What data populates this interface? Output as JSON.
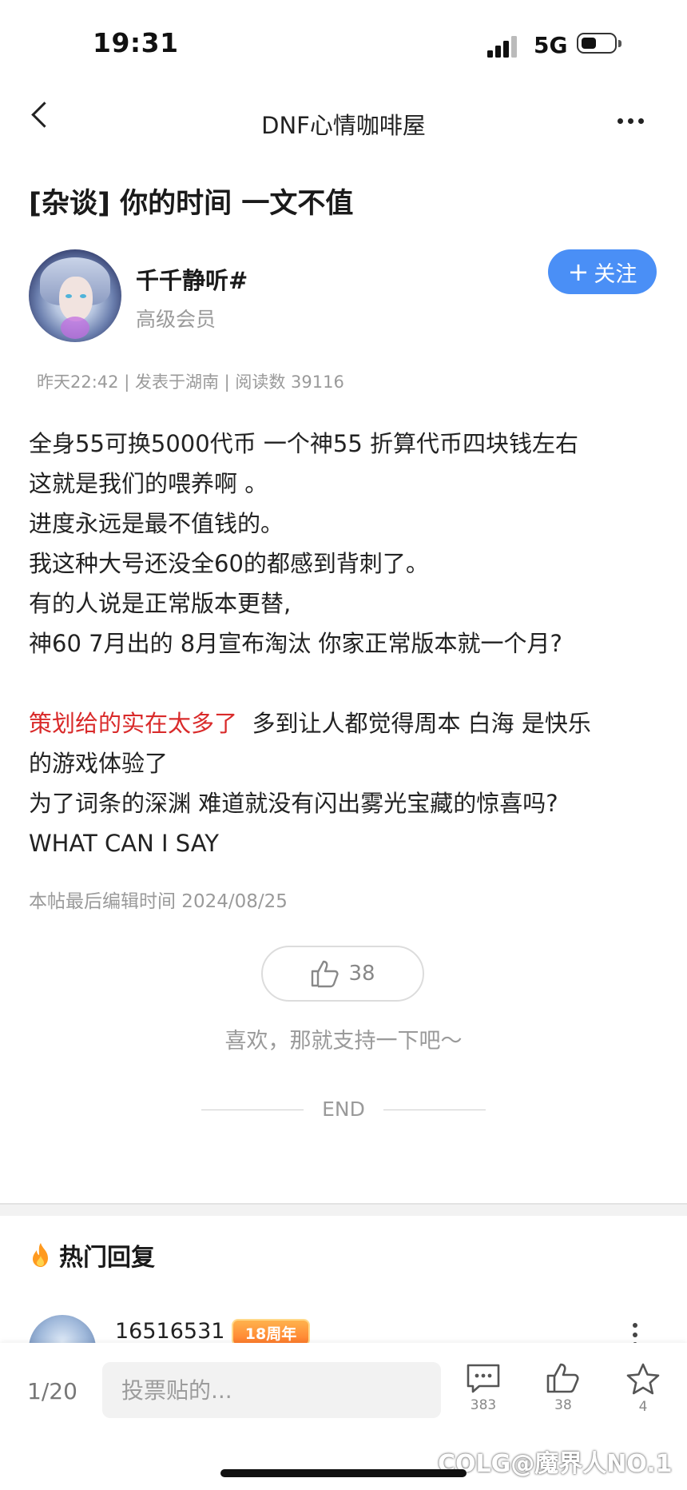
{
  "status_bar": {
    "time": "19:31",
    "network": "5G"
  },
  "nav": {
    "title": "DNF心情咖啡屋"
  },
  "post": {
    "title": "[杂谈] 你的时间 一文不值",
    "author": {
      "name": "千千静听#",
      "level": "高级会员"
    },
    "follow_label": "关注",
    "meta": "昨天22:42 | 发表于湖南 | 阅读数 39116",
    "paragraph1": [
      "全身55可换5000代币 一个神55 折算代币四块钱左右",
      "这就是我们的喂养啊 。",
      "进度永远是最不值钱的。",
      "我这种大号还没全60的都感到背刺了。",
      "有的人说是正常版本更替,",
      "神60 7月出的 8月宣布淘汰 你家正常版本就一个月?"
    ],
    "highlight": "策划给的实在太多了",
    "highlight_rest": "  多到让人都觉得周本 白海 是快乐",
    "paragraph2": [
      "的游戏体验了",
      "为了词条的深渊  难道就没有闪出雾光宝藏的惊喜吗?",
      "WHAT CAN I SAY"
    ],
    "edited": "本帖最后编辑时间 2024/08/25",
    "likes": "38",
    "support_text": "喜欢，那就支持一下吧～",
    "end_text": "END"
  },
  "hot_replies": {
    "header": "热门回复",
    "first": {
      "name": "16516531",
      "badge": "18周年"
    }
  },
  "bottom_bar": {
    "page": "1/20",
    "input_placeholder": "投票贴的...",
    "comments": "383",
    "likes": "38",
    "favorites": "4"
  },
  "watermark": "COLG@魔界人NO.1",
  "colors": {
    "accent": "#4a8ff6",
    "highlight_red": "#d92a2a",
    "fire": "#ff9a1f"
  }
}
